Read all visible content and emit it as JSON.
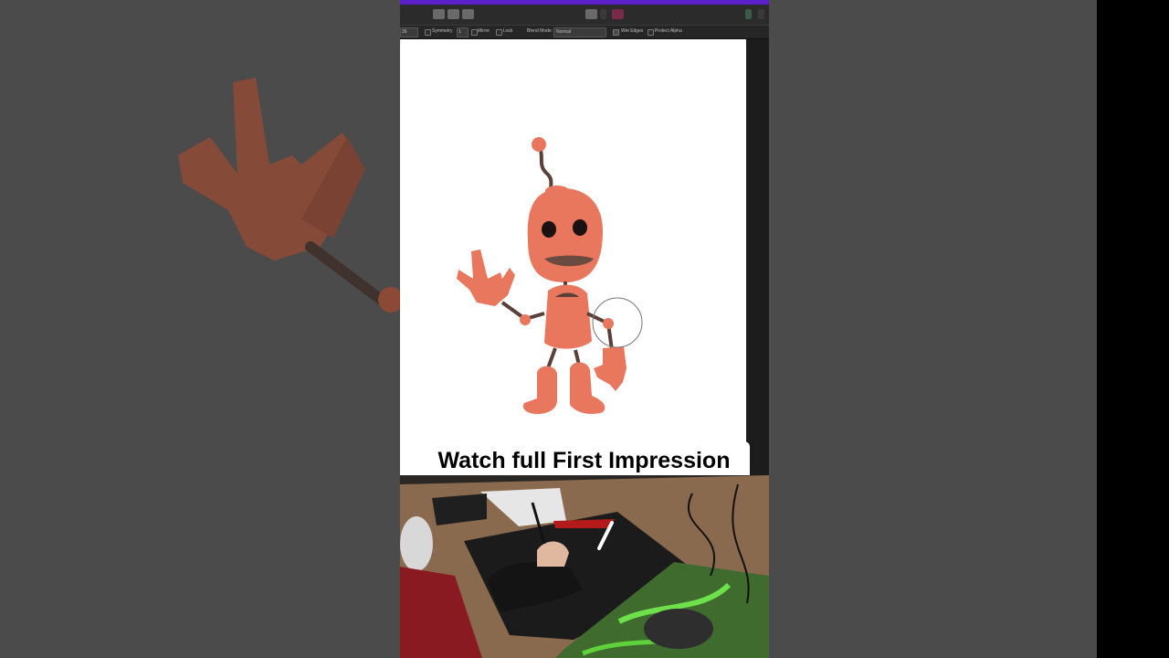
{
  "context_bar": {
    "size_value": "36",
    "symmetry_label": "Symmetry",
    "symmetry_value": "1",
    "mirror_label": "Mirror",
    "lock_label": "Lock",
    "blend_mode_label": "Blend Mode:",
    "blend_mode_value": "Normal",
    "wet_edges_label": "Wet Edges",
    "protect_alpha_label": "Protect Alpha"
  },
  "caption": {
    "text": "Watch full First Impression"
  },
  "colors": {
    "accent_bar": "#5b1fc9",
    "robot_body": "#e8775e",
    "robot_dark": "#5a4038",
    "canvas": "#ffffff"
  },
  "icons": [
    "move-tool-icon",
    "selection-tool-icon",
    "transform-tool-icon",
    "layers-icon",
    "color-icon",
    "brush-icon"
  ]
}
